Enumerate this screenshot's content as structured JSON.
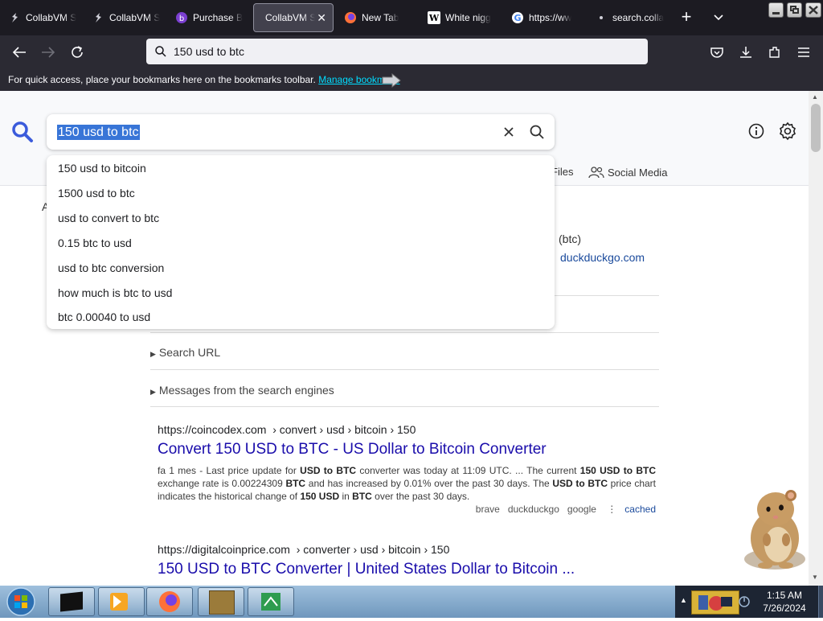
{
  "browser": {
    "tabs": [
      {
        "label": "CollabVM S",
        "icon": "collabvm-icon"
      },
      {
        "label": "CollabVM S",
        "icon": "collabvm-icon"
      },
      {
        "label": "Purchase B",
        "icon": "purchase-icon"
      },
      {
        "label": "CollabVM S",
        "icon": "collabvm-icon",
        "active": true
      },
      {
        "label": "New Tab",
        "icon": "firefox-icon"
      },
      {
        "label": "White nigg",
        "icon": "wikipedia-icon"
      },
      {
        "label": "https://ww",
        "icon": "google-icon"
      },
      {
        "label": "search.colla",
        "icon": "dot-icon"
      }
    ],
    "address": "150 usd to btc",
    "bookmarks_message": "For quick access, place your bookmarks here on the bookmarks toolbar.",
    "bookmarks_link": "Manage bookma…",
    "colors": {
      "tabbar": "#1c1b22",
      "toolbar": "#2b2a33",
      "link": "#00ddff"
    }
  },
  "search": {
    "query": "150 usd to btc",
    "suggestions": [
      "150 usd to bitcoin",
      "1500 usd to btc",
      "usd to convert to btc",
      "0.15 btc to usd",
      "usd to btc conversion",
      "how much is btc to usd",
      "btc 0.00040 to usd"
    ],
    "tabs": {
      "files": "Files",
      "social": "Social Media"
    },
    "partial_left": "A",
    "partial_info": "(btc)",
    "partial_source": "duckduckgo.com",
    "sections": [
      "Search URL",
      "Messages from the search engines"
    ],
    "results": [
      {
        "url": "https://coincodex.com",
        "path": "› convert › usd › bitcoin › 150",
        "title": "Convert 150 USD to BTC - US Dollar to Bitcoin Converter",
        "snippet_parts": [
          "fa 1 mes - Last price update for ",
          "USD to BTC",
          " converter was today at 11:09 UTC. ... The current ",
          "150 USD to BTC",
          " exchange rate is 0.00224309 ",
          "BTC",
          " and has increased by 0.01% over the past 30 days. The ",
          "USD to BTC",
          " price chart indicates the historical change of ",
          "150 USD",
          " in ",
          "BTC",
          " over the past 30 days."
        ],
        "engines": [
          "brave",
          "duckduckgo",
          "google"
        ],
        "cached": "cached"
      },
      {
        "url": "https://digitalcoinprice.com",
        "path": "› converter › usd › bitcoin › 150",
        "title": "150 USD to BTC Converter | United States Dollar to Bitcoin ..."
      }
    ],
    "colors": {
      "link": "#1a0dab",
      "brand": "#3b5bdb",
      "selection": "#3875d7"
    }
  },
  "taskbar": {
    "time": "1:15 AM",
    "date": "7/26/2024",
    "apps": [
      "terminal-app",
      "media-player-app",
      "firefox-app",
      "bonzi-app",
      "green-app"
    ]
  }
}
